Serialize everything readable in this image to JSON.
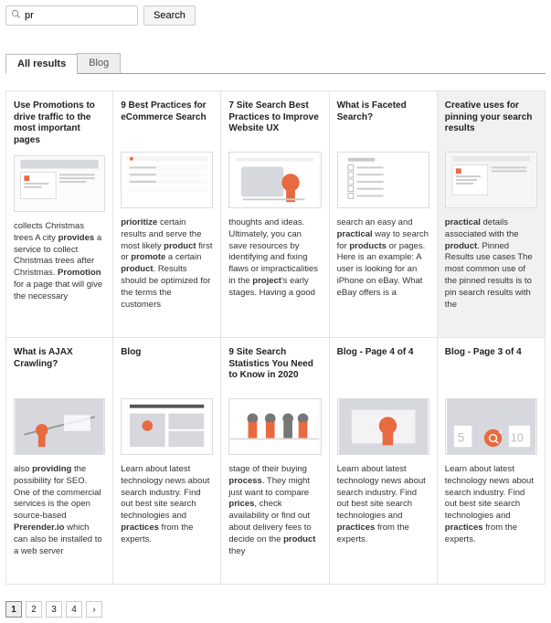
{
  "search": {
    "value": "pr",
    "button": "Search"
  },
  "tabs": [
    {
      "label": "All results",
      "active": true
    },
    {
      "label": "Blog",
      "active": false
    }
  ],
  "pagination": {
    "pages": [
      "1",
      "2",
      "3",
      "4"
    ],
    "next": "›",
    "current": 1
  },
  "results": [
    {
      "title": "Use Promotions to drive traffic to the most important pages",
      "snippet": "collects Christmas trees A city <b>provides</b> a service to collect Christmas trees after Christmas. <b>Promotion</b> for a page that will give the necessary",
      "thumb": "doc",
      "pinned": false
    },
    {
      "title": "9 Best Practices for eCommerce Search",
      "snippet": "<b>prioritize</b> certain results and serve the most likely <b>product</b> first or <b>promote</b> a certain <b>product</b>. Results should be optimized for the terms the customers",
      "thumb": "list",
      "pinned": false
    },
    {
      "title": "7 Site Search Best Practices to Improve Website UX",
      "snippet": "thoughts and ideas. Ultimately, you can save resources by identifying and fixing flaws or impracticalities in the <b>project</b>'s early stages. Having a good",
      "thumb": "illus",
      "pinned": false
    },
    {
      "title": "What is Faceted Search?",
      "snippet": "search an easy and <b>practical</b> way to search for <b>products</b> or pages. Here is an example: A user is looking for an iPhone on eBay. What eBay offers is a",
      "thumb": "facets",
      "pinned": false
    },
    {
      "title": "Creative uses for pinning your search results",
      "snippet": "<b>practical</b> details associated with the <b>product</b>. Pinned Results use cases The most common use of the pinned results is to pin search results with the",
      "thumb": "pin",
      "pinned": true
    },
    {
      "title": "What is AJAX Crawling?",
      "snippet": "also <b>providing</b> the possibility for SEO. One of the commercial services is the open source-based <b>Prerender.io</b> which can also be installed to a web server",
      "thumb": "ajax",
      "pinned": false
    },
    {
      "title": "Blog",
      "snippet": "Learn about latest technology news about search industry. Find out best site search technologies and <b>practices</b> from the experts.",
      "thumb": "blog",
      "pinned": false
    },
    {
      "title": "9 Site Search Statistics You Need to Know in 2020",
      "snippet": "stage of their buying <b>process</b>. They might just want to compare <b>prices</b>, check availability or find out about delivery fees to decide on the <b>product</b> they",
      "thumb": "people",
      "pinned": false
    },
    {
      "title": "Blog - Page 4 of 4",
      "snippet": "Learn about latest technology news about search industry. Find out best site search technologies and <b>practices</b> from the experts.",
      "thumb": "blog2",
      "pinned": false
    },
    {
      "title": "Blog - Page 3 of 4",
      "snippet": "Learn about latest technology news about search industry. Find out best site search technologies and <b>practices</b> from the experts.",
      "thumb": "blog3",
      "pinned": false
    }
  ],
  "thumb_colors": {
    "orange": "#e86a3f",
    "gray": "#d6d8de",
    "dark": "#777",
    "text": "#ccc"
  }
}
